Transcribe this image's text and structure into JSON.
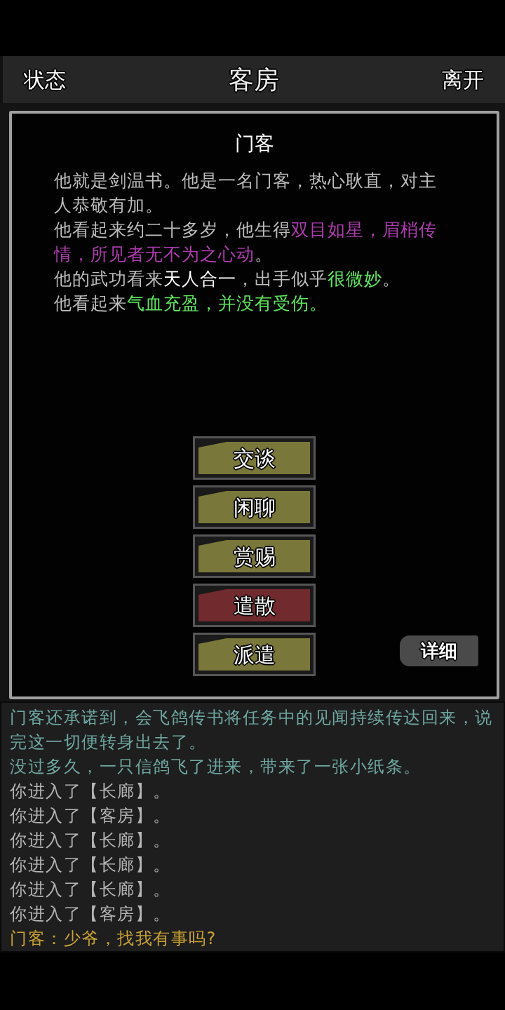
{
  "top_bar": {
    "left_button": "状态",
    "title": "客房",
    "right_button": "离开"
  },
  "dialog": {
    "title": "门客",
    "description": [
      {
        "segments": [
          {
            "text": "他就是剑温书。他是一名门客，热心耿直，对主人恭敬有加。",
            "color": "#bdbdbd"
          }
        ]
      },
      {
        "segments": [
          {
            "text": "他看起来约二十多岁，他生得",
            "color": "#bdbdbd"
          },
          {
            "text": "双目如星，眉梢传情，所见者无不为之心动",
            "color": "#b03cb0"
          },
          {
            "text": "。",
            "color": "#bdbdbd"
          }
        ]
      },
      {
        "segments": [
          {
            "text": "他的武功看来",
            "color": "#bdbdbd"
          },
          {
            "text": "天人合一",
            "color": "#ffffff"
          },
          {
            "text": "，出手似乎",
            "color": "#bdbdbd"
          },
          {
            "text": "很微妙",
            "color": "#5ee85e"
          },
          {
            "text": "。",
            "color": "#bdbdbd"
          }
        ]
      },
      {
        "segments": [
          {
            "text": "他看起来",
            "color": "#bdbdbd"
          },
          {
            "text": "气血充盈，并没有受伤。",
            "color": "#5ee85e"
          }
        ]
      }
    ],
    "actions": [
      {
        "label": "交谈",
        "color": "#7a773a"
      },
      {
        "label": "闲聊",
        "color": "#7a773a"
      },
      {
        "label": "赏赐",
        "color": "#7a773a"
      },
      {
        "label": "遣散",
        "color": "#712a2e"
      },
      {
        "label": "派遣",
        "color": "#7a773a"
      }
    ],
    "detail_button": "详细"
  },
  "log": [
    {
      "text": "门客还承诺到，会飞鸽传书将任务中的见闻持续传达回来，说完这一切便转身出去了。",
      "color": "#6fa8a2"
    },
    {
      "text": "没过多久，一只信鸽飞了进来，带来了一张小纸条。",
      "color": "#6fa8a2"
    },
    {
      "text": "你进入了【长廊】。",
      "color": "#b5b5b5"
    },
    {
      "text": "你进入了【客房】。",
      "color": "#b5b5b5"
    },
    {
      "text": "你进入了【长廊】。",
      "color": "#b5b5b5"
    },
    {
      "text": "你进入了【长廊】。",
      "color": "#b5b5b5"
    },
    {
      "text": "你进入了【长廊】。",
      "color": "#b5b5b5"
    },
    {
      "text": "你进入了【客房】。",
      "color": "#b5b5b5"
    },
    {
      "text": "门客：少爷，找我有事吗?",
      "color": "#c9a233"
    }
  ]
}
